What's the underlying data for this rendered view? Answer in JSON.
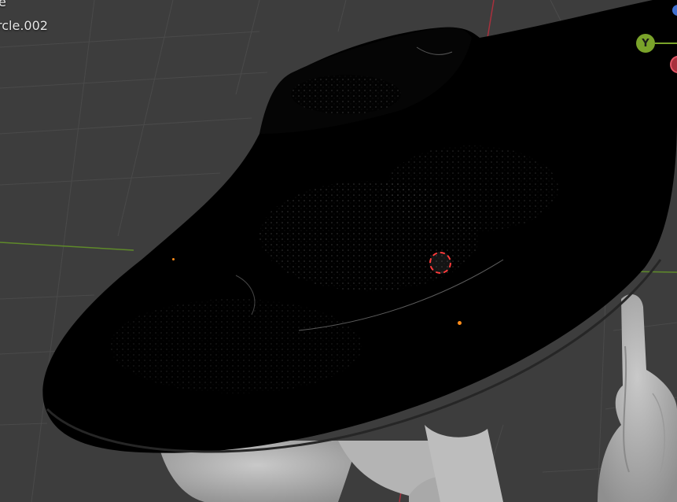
{
  "viewport": {
    "view_label": "e",
    "object_label": "rcle.002",
    "background_color": "#3d3d3d",
    "grid_color": "#484848",
    "axis_colors": {
      "x": "#a8303d",
      "y": "#7aa32a",
      "z": "#3f6fd0"
    }
  },
  "gizmo": {
    "y_label": "Y"
  },
  "icons": {
    "navigation_gizmo": "axis-gizmo-icon",
    "cursor": "3d-cursor-icon",
    "origin": "origin-point-icon"
  }
}
